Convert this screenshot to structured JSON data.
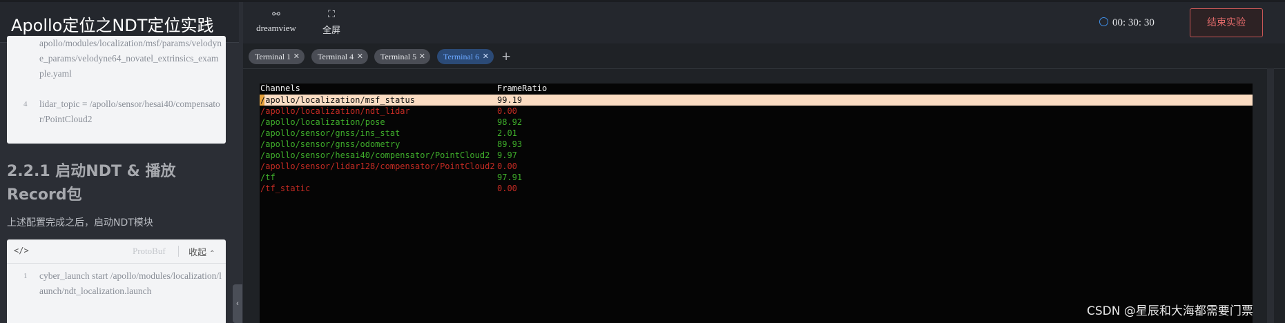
{
  "left_panel": {
    "title": "Apollo定位之NDT定位实践",
    "code_card_1": {
      "lines": [
        {
          "num": "",
          "text": "apollo/modules/localization/msf/params/velodyne_params/velodyne64_novatel_extrinsics_example.yaml"
        },
        {
          "num": "4",
          "text": "lidar_topic = /apollo/sensor/hesai40/compensator/PointCloud2"
        }
      ]
    },
    "section_heading": "2.2.1 启动NDT & 播放Record包",
    "paragraph": "上述配置完成之后，启动NDT模块",
    "code_card_2": {
      "code_icon": "</>",
      "language": "ProtoBuf",
      "collapse_label": "收起",
      "lines": [
        {
          "num": "1",
          "text": "cyber_launch start /apollo/modules/localization/launch/ndt_localization.launch"
        }
      ]
    },
    "collapse_handle_icon": "chevron-left-icon"
  },
  "toolbar": {
    "dreamview_label": "dreamview",
    "dreamview_icon": "link-icon",
    "fullscreen_label": "全屏",
    "fullscreen_icon": "expand-icon",
    "timer_text": "00: 30: 30",
    "end_button_label": "结束实验"
  },
  "tabs": [
    {
      "label": "Terminal 1",
      "active": false
    },
    {
      "label": "Terminal 4",
      "active": false
    },
    {
      "label": "Terminal 5",
      "active": false
    },
    {
      "label": "Terminal 6",
      "active": true
    }
  ],
  "terminal": {
    "header": {
      "channels": "Channels",
      "frame_ratio": "FrameRatio"
    },
    "rows": [
      {
        "channel": "/apollo/localization/msf_status",
        "ratio": "99.19",
        "status": "selected"
      },
      {
        "channel": "/apollo/localization/ndt_lidar",
        "ratio": "0.00",
        "status": "inactive"
      },
      {
        "channel": "/apollo/localization/pose",
        "ratio": "98.92",
        "status": "active"
      },
      {
        "channel": "/apollo/sensor/gnss/ins_stat",
        "ratio": "2.01",
        "status": "active"
      },
      {
        "channel": "/apollo/sensor/gnss/odometry",
        "ratio": "89.93",
        "status": "active"
      },
      {
        "channel": "/apollo/sensor/hesai40/compensator/PointCloud2",
        "ratio": "9.97",
        "status": "active"
      },
      {
        "channel": "/apollo/sensor/lidar128/compensator/PointCloud2",
        "ratio": "0.00",
        "status": "inactive"
      },
      {
        "channel": "/tf",
        "ratio": "97.91",
        "status": "active"
      },
      {
        "channel": "/tf_static",
        "ratio": "0.00",
        "status": "inactive"
      }
    ],
    "colors": {
      "active": "#3fae2b",
      "inactive": "#c42b23",
      "selected_bg": "#fbdcc2"
    }
  },
  "watermark": "CSDN @星辰和大海都需要门票"
}
